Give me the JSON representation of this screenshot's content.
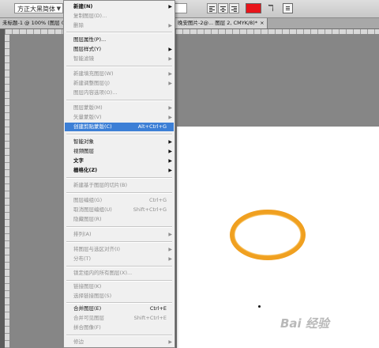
{
  "toolbar": {
    "font_family": "方正大黑简体",
    "font_style": "普",
    "color_swatch": "#e8151b",
    "warp_icon": "warp-text-icon",
    "panel_icon": "character-panel-icon"
  },
  "tabs": [
    {
      "label": "未标题-1 @ 100% (图层 0...",
      "close": "×"
    },
    {
      "label": "晚安图片-2@... 图层 2, CMYK/8)*",
      "close": "×"
    }
  ],
  "menu": {
    "items": [
      {
        "label": "新建(N)",
        "shortcut": "",
        "submenu": true,
        "disabled": false,
        "bold": true
      },
      {
        "label": "复制图层(D)...",
        "shortcut": "",
        "submenu": false,
        "disabled": true
      },
      {
        "label": "删除",
        "shortcut": "",
        "submenu": true,
        "disabled": true
      },
      {
        "label": "图层属性(P)...",
        "shortcut": "",
        "submenu": false,
        "disabled": false
      },
      {
        "label": "图层样式(Y)",
        "shortcut": "",
        "submenu": true,
        "disabled": false
      },
      {
        "label": "智能滤镜",
        "shortcut": "",
        "submenu": true,
        "disabled": true
      },
      {
        "label": "新建填充图层(W)",
        "shortcut": "",
        "submenu": true,
        "disabled": true
      },
      {
        "label": "新建调整图层(J)",
        "shortcut": "",
        "submenu": true,
        "disabled": true
      },
      {
        "label": "图层内容选项(O)...",
        "shortcut": "",
        "submenu": false,
        "disabled": true
      },
      {
        "label": "图层蒙版(M)",
        "shortcut": "",
        "submenu": true,
        "disabled": true
      },
      {
        "label": "矢量蒙版(V)",
        "shortcut": "",
        "submenu": true,
        "disabled": true
      },
      {
        "label": "创建剪贴蒙版(C)",
        "shortcut": "Alt+Ctrl+G",
        "submenu": false,
        "disabled": false,
        "highlighted": true
      },
      {
        "label": "智能对象",
        "shortcut": "",
        "submenu": true,
        "disabled": false
      },
      {
        "label": "视频图层",
        "shortcut": "",
        "submenu": true,
        "disabled": false
      },
      {
        "label": "文字",
        "shortcut": "",
        "submenu": true,
        "disabled": false
      },
      {
        "label": "栅格化(Z)",
        "shortcut": "",
        "submenu": true,
        "disabled": false
      },
      {
        "label": "新建基于图层的切片(B)",
        "shortcut": "",
        "submenu": false,
        "disabled": true
      },
      {
        "label": "图层编组(G)",
        "shortcut": "Ctrl+G",
        "submenu": false,
        "disabled": true
      },
      {
        "label": "取消图层编组(U)",
        "shortcut": "Shift+Ctrl+G",
        "submenu": false,
        "disabled": true
      },
      {
        "label": "隐藏图层(R)",
        "shortcut": "",
        "submenu": false,
        "disabled": true
      },
      {
        "label": "排列(A)",
        "shortcut": "",
        "submenu": true,
        "disabled": true
      },
      {
        "label": "将图层与选区对齐(I)",
        "shortcut": "",
        "submenu": true,
        "disabled": true
      },
      {
        "label": "分布(T)",
        "shortcut": "",
        "submenu": true,
        "disabled": true
      },
      {
        "label": "锁定组内的所有图层(X)...",
        "shortcut": "",
        "submenu": false,
        "disabled": true
      },
      {
        "label": "链接图层(K)",
        "shortcut": "",
        "submenu": false,
        "disabled": true
      },
      {
        "label": "选择链接图层(S)",
        "shortcut": "",
        "submenu": false,
        "disabled": true
      },
      {
        "label": "合并图层(E)",
        "shortcut": "Ctrl+E",
        "submenu": false,
        "disabled": false
      },
      {
        "label": "合并可见图层",
        "shortcut": "Shift+Ctrl+E",
        "submenu": false,
        "disabled": true
      },
      {
        "label": "拼合图像(F)",
        "shortcut": "",
        "submenu": false,
        "disabled": true
      },
      {
        "label": "修边",
        "shortcut": "",
        "submenu": true,
        "disabled": true
      }
    ]
  },
  "canvas": {
    "document_bg": "#ffffff",
    "ellipse_color": "#f0a020"
  },
  "watermark": "Bai 经验"
}
